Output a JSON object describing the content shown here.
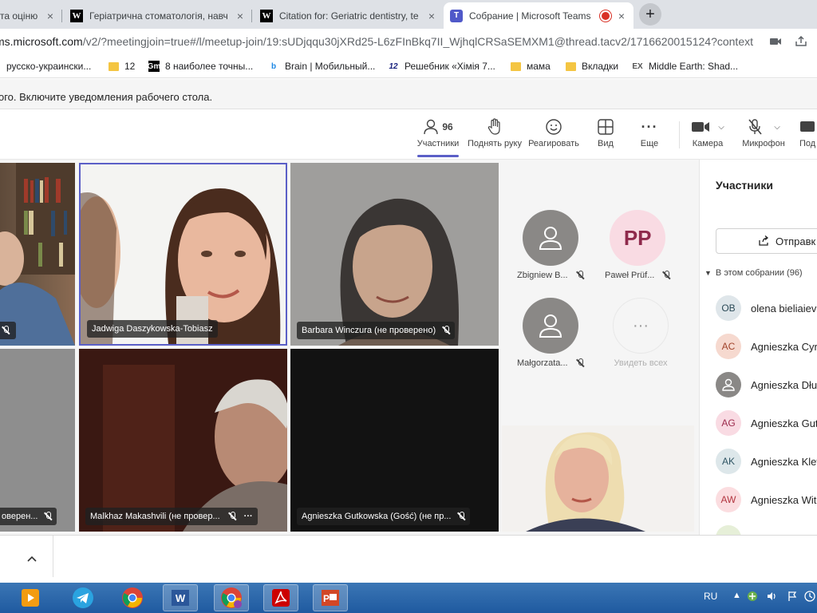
{
  "browser": {
    "tabs": [
      {
        "title": "та оцінювання",
        "favicon": "generic",
        "close": "×"
      },
      {
        "title": "Геріатрична стоматологія, навча",
        "favicon": "W",
        "close": "×"
      },
      {
        "title": "Citation for: Geriatric dentistry, te",
        "favicon": "W",
        "close": "×"
      },
      {
        "title": "Собрание | Microsoft Teams",
        "favicon": "teams-logo",
        "close": "×",
        "recording": true
      }
    ],
    "new_tab": "+",
    "url": {
      "domain": "ms.microsoft.com",
      "path": "/v2/?meetingjoin=true#/l/meetup-join/19:sUDjqqu30jXRd25-L6zFInBkq7II_WjhqlCRSaSEMXM1@thread.tacv2/1716620015124?context=..."
    },
    "bookmarks": [
      {
        "label": "русско-украински...",
        "icon": "text"
      },
      {
        "label": "12",
        "icon": "folder"
      },
      {
        "label": "8 наиболее точны...",
        "icon": "gm-logo"
      },
      {
        "label": "Brain | Мобильный...",
        "icon": "brain-logo"
      },
      {
        "label": "Решебник «Хімія 7...",
        "icon": "12-logo"
      },
      {
        "label": "мама",
        "icon": "folder"
      },
      {
        "label": "Вкладки",
        "icon": "folder"
      },
      {
        "label": "Middle Earth: Shad...",
        "icon": "ex-logo"
      }
    ]
  },
  "notification": {
    "text": "ого. Включите уведомления рабочего стола."
  },
  "toolbar": {
    "participants": {
      "label": "Участники",
      "count": "96"
    },
    "raise_hand": {
      "label": "Поднять руку"
    },
    "react": {
      "label": "Реагировать"
    },
    "view": {
      "label": "Вид"
    },
    "more": {
      "label": "Еще"
    },
    "camera": {
      "label": "Камера"
    },
    "microphone": {
      "label": "Микрофон"
    },
    "share": {
      "label": "Под"
    }
  },
  "tiles": [
    {
      "name": "",
      "muted": true
    },
    {
      "name": "Jadwiga Daszykowska-Tobiasz",
      "muted": false,
      "active_speaker": true
    },
    {
      "name": "Barbara Winczura (не проверено)",
      "muted": true
    },
    {
      "name": "оверен...",
      "muted": true
    },
    {
      "name": "Malkhaz Makashvili (не провер...",
      "muted": true,
      "more": "···"
    },
    {
      "name": "Agnieszka Gutkowska (Gość) (не пр...",
      "muted": true
    },
    {
      "name": "",
      "muted": false
    }
  ],
  "roster": [
    {
      "name": "Zbigniew B...",
      "avatar": "person-icon",
      "muted": true
    },
    {
      "name": "Paweł Prüf...",
      "avatar": "PP",
      "muted": true
    },
    {
      "name": "Małgorzata...",
      "avatar": "person-icon",
      "muted": true
    },
    {
      "name": "Увидеть всех",
      "avatar": "···",
      "muted": false
    }
  ],
  "panel": {
    "title": "Участники",
    "invite": "Отправк",
    "section": "В этом собрании (96)",
    "people": [
      {
        "initials": "OB",
        "name": "olena bieliaiev",
        "bg": "#dfe6ea",
        "fg": "#2b4a57"
      },
      {
        "initials": "AC",
        "name": "Agnieszka Cyr",
        "bg": "#f6d9cf",
        "fg": "#a1432b"
      },
      {
        "initials": "",
        "name": "Agnieszka Dłu",
        "bg": "#8a8886",
        "fg": "#fff",
        "icon": "person-icon"
      },
      {
        "initials": "AG",
        "name": "Agnieszka Gut",
        "bg": "#f9dbe3",
        "fg": "#9c2b4c"
      },
      {
        "initials": "AK",
        "name": "Agnieszka Klev",
        "bg": "#dde7ea",
        "fg": "#2f5564"
      },
      {
        "initials": "AW",
        "name": "Agnieszka Wit",
        "bg": "#fbdde0",
        "fg": "#b2353f"
      }
    ]
  },
  "taskbar": {
    "lang": "RU",
    "apps": [
      "video-player-icon",
      "telegram-icon",
      "chrome-icon",
      "word-icon",
      "chrome-profile-icon",
      "acrobat-icon",
      "powerpoint-icon"
    ]
  }
}
